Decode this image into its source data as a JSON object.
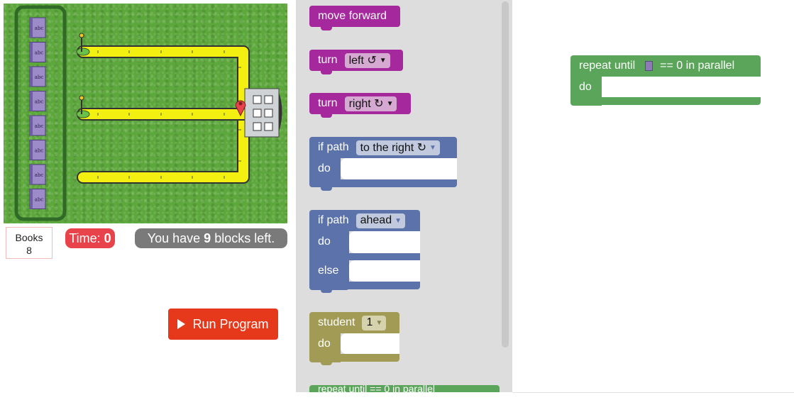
{
  "status": {
    "books_label": "Books",
    "books_count": "8",
    "time_label": "Time:",
    "time_value": "0",
    "blocks_prefix": "You have",
    "blocks_count": "9",
    "blocks_suffix": "blocks left."
  },
  "run_button": {
    "label": "Run Program"
  },
  "book_icon_text": "abc",
  "toolbox": {
    "move_forward": "move forward",
    "turn_left": {
      "label": "turn",
      "value": "left ↺"
    },
    "turn_right": {
      "label": "turn",
      "value": "right ↻"
    },
    "if_path_right": {
      "label": "if path",
      "value": "to the right ↻",
      "do": "do"
    },
    "if_path_ahead": {
      "label": "if path",
      "value": "ahead",
      "do": "do",
      "else": "else"
    },
    "student": {
      "label": "student",
      "value": "1",
      "do": "do"
    },
    "partial_block_text": "repeat until  == 0 in parallel"
  },
  "workspace": {
    "repeat_until": {
      "label": "repeat until",
      "suffix": "== 0 in parallel",
      "do": "do"
    }
  },
  "colors": {
    "move_forward": "#a5289d",
    "turn": "#a5289d",
    "if_path": "#5b72aa",
    "student": "#a19b55",
    "repeat": "#5ba55b",
    "run": "#e6391c",
    "time": "#e8424a"
  }
}
